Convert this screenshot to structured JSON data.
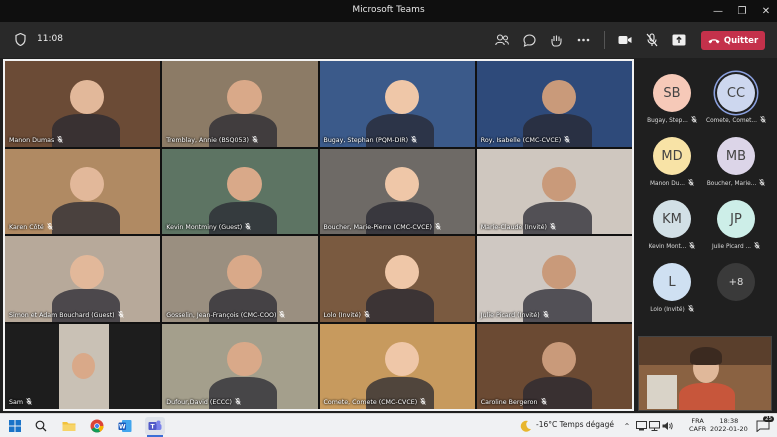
{
  "window": {
    "title": "Microsoft Teams"
  },
  "toolbar": {
    "time": "11:08",
    "quit_label": "Quitter"
  },
  "tiles": [
    {
      "name": "Manon Dumas",
      "bg": "#6b4b36"
    },
    {
      "name": "Tremblay, Annie (BSQ053)",
      "bg": "#8c7b66"
    },
    {
      "name": "Bugay, Stephan (PQM-DIR)",
      "bg": "#3b5a8a"
    },
    {
      "name": "Roy, Isabelle (CMC-CVCE)",
      "bg": "#2e4a7a"
    },
    {
      "name": "Karen Côté",
      "bg": "#b08a63"
    },
    {
      "name": "Kevin Montminy (Guest)",
      "bg": "#5d7463"
    },
    {
      "name": "Boucher, Marie-Pierre (CMC-CVCE)",
      "bg": "#6e6a66"
    },
    {
      "name": "Marie-Claude (Invité)",
      "bg": "#cfc7bf"
    },
    {
      "name": "Simon et Adam Bouchard (Guest)",
      "bg": "#b7a99a"
    },
    {
      "name": "Gosselin, Jean-François (CMC-COO)",
      "bg": "#9a8f80"
    },
    {
      "name": "Lolo (Invité)",
      "bg": "#7a5a40"
    },
    {
      "name": "Julie Picard (Invité)",
      "bg": "#cfc8c2"
    },
    {
      "name": "Sam",
      "bg": "#1d1d1d"
    },
    {
      "name": "Dufour,David (ECCC)",
      "bg": "#a49f8c"
    },
    {
      "name": "Comete, Comete (CMC-CVCE)",
      "bg": "#c79a5e"
    },
    {
      "name": "Caroline Bergeron",
      "bg": "#6b4a33"
    }
  ],
  "participants": [
    {
      "initials": "SB",
      "name": "Bugay, Step...",
      "color": "#f6c9b8"
    },
    {
      "initials": "CC",
      "name": "Comete, Comet...",
      "color": "#cdd7ef"
    },
    {
      "initials": "MD",
      "name": "Manon Du...",
      "color": "#f8e3a6"
    },
    {
      "initials": "MB",
      "name": "Boucher, Marie...",
      "color": "#dcd5e8"
    },
    {
      "initials": "KM",
      "name": "Kevin Mont...",
      "color": "#d2e0e6"
    },
    {
      "initials": "JP",
      "name": "Julie Picard ...",
      "color": "#cdeee8"
    },
    {
      "initials": "L",
      "name": "Lolo (Invité)",
      "color": "#cfe0f2"
    },
    {
      "initials": "+8",
      "name": "",
      "color": "#3a3a3a"
    }
  ],
  "taskbar": {
    "weather": "-16°C  Temps dégagé",
    "lang1": "FRA",
    "lang2": "CAFR",
    "time": "18:38",
    "date": "2022-01-20",
    "notif_count": "25"
  }
}
